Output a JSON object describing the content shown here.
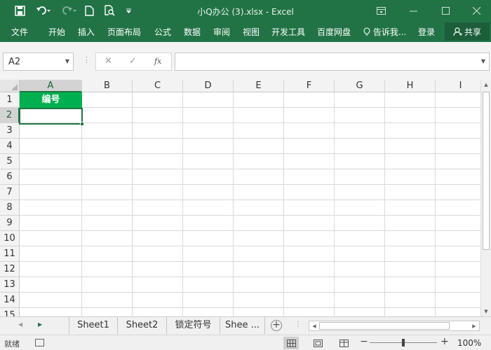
{
  "titlebar": {
    "title": "小Q办公 (3).xlsx  -  Excel",
    "qat": [
      {
        "icon": "save-icon"
      },
      {
        "icon": "undo-icon"
      },
      {
        "icon": "redo-icon"
      },
      {
        "icon": "new-file-icon"
      },
      {
        "icon": "print-preview-icon"
      },
      {
        "icon": "customize-qat-icon"
      }
    ],
    "window_controls": [
      "ribbon-display-options-icon",
      "minimize-icon",
      "maximize-icon",
      "close-icon"
    ]
  },
  "ribbon": {
    "tabs": [
      "文件",
      "开始",
      "插入",
      "页面布局",
      "公式",
      "数据",
      "审阅",
      "视图",
      "开发工具",
      "百度网盘"
    ],
    "tell_me": "告诉我...",
    "login": "登录",
    "share": "共享"
  },
  "formula_bar": {
    "name_box": "A2",
    "fx_label": "fx",
    "formula_value": ""
  },
  "grid": {
    "columns": [
      "A",
      "B",
      "C",
      "D",
      "E",
      "F",
      "G",
      "H",
      "I"
    ],
    "rows": [
      "1",
      "2",
      "3",
      "4",
      "5",
      "6",
      "7",
      "8",
      "9",
      "10",
      "11",
      "12",
      "13",
      "14",
      "15"
    ],
    "cells": {
      "A1": "编号"
    },
    "selected_cell": "A2",
    "header_fill": "#00b050"
  },
  "sheet_tabs": {
    "tabs": [
      "Sheet1",
      "Sheet2",
      "锁定符号",
      "Shee ..."
    ]
  },
  "status_bar": {
    "status": "就绪",
    "zoom": "100%",
    "zoom_percent": 100
  },
  "colors": {
    "accent": "#217346",
    "selected_cell_fill": "#00b050"
  }
}
